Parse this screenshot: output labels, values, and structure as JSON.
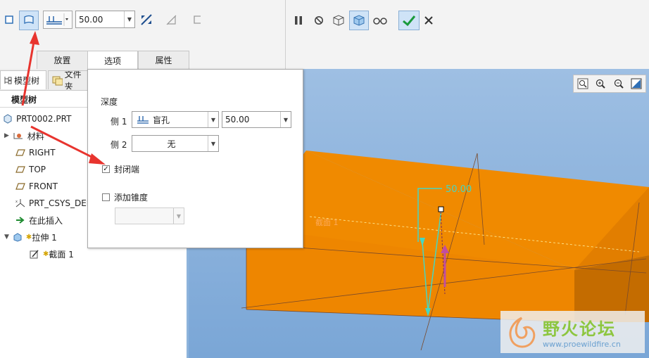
{
  "toolbar": {
    "depth_value": "50.00",
    "icons": [
      "solid-icon",
      "surface-icon",
      "blind-depth-icon",
      "flip-direction-icon",
      "remove-material-icon",
      "thicken-icon",
      "pause-icon",
      "no-preview-icon",
      "geometry-preview-icon",
      "verify-icon",
      "glasses-icon",
      "ok-check-icon",
      "cancel-x-icon"
    ]
  },
  "tabs": [
    "放置",
    "选项",
    "属性"
  ],
  "tree": {
    "tab_model": "模型树",
    "tab_files": "文件夹",
    "header": "模型树",
    "root": "PRT0002.PRT",
    "items": [
      "材料",
      "RIGHT",
      "TOP",
      "FRONT",
      "PRT_CSYS_DEF",
      "在此插入",
      "拉伸 1",
      "截面 1"
    ]
  },
  "options_panel": {
    "depth_label": "深度",
    "side1_label": "侧 1",
    "side1_type": "盲孔",
    "side1_value": "50.00",
    "side2_label": "侧 2",
    "side2_type": "无",
    "capped_ends_label": "封闭端",
    "capped_ends_checked": true,
    "taper_label": "添加锥度",
    "taper_checked": false
  },
  "viewport": {
    "dimension_label": "50.00",
    "sketch_label": "截面 1",
    "colors": {
      "solid": "#f08a00",
      "solid_dark": "#c46c00",
      "dim_line": "#45d7c2",
      "marker": "#c14ea0"
    }
  },
  "watermark": {
    "name": "野火论坛",
    "url": "www.proewildfire.cn"
  }
}
